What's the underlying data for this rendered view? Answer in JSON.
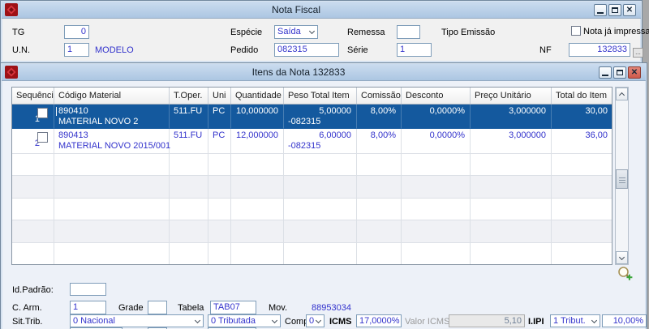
{
  "window1": {
    "title": "Nota Fiscal",
    "tg_label": "TG",
    "tg_value": "0",
    "un_label": "U.N.",
    "un_value": "1",
    "un_desc": "MODELO",
    "especie_label": "Espécie",
    "especie_value": "Saída",
    "pedido_label": "Pedido",
    "pedido_value": "082315",
    "remessa_label": "Remessa",
    "remessa_value": "",
    "serie_label": "Série",
    "serie_value": "1",
    "tipo_emissao_label": "Tipo Emissão",
    "nota_impressa_label": "Nota já impressa",
    "nf_label": "NF",
    "nf_value": "132833",
    "nf_browse_label": "..."
  },
  "window2": {
    "title": "Itens da Nota 132833",
    "table": {
      "headers": [
        "Sequência",
        "Código Material",
        "T.Oper.",
        "Uni",
        "Quantidade",
        "Peso Total Item",
        "Comissão",
        "Desconto",
        "Preço Unitário",
        "Total do Item"
      ],
      "rows": [
        {
          "seq": "1",
          "code": "890410",
          "desc": "MATERIAL NOVO 2",
          "toper": "511.FU",
          "uni": "PC",
          "qty": "10,000000",
          "ref": "-082315",
          "peso": "5,00000",
          "comissao": "8,00%",
          "desconto": "0,0000%",
          "preco": "3,000000",
          "total": "30,00",
          "selected": true
        },
        {
          "seq": "2",
          "code": "890413",
          "desc": "MATERIAL NOVO 2015/001",
          "toper": "511.FU",
          "uni": "PC",
          "qty": "12,000000",
          "ref": "-082315",
          "peso": "6,00000",
          "comissao": "8,00%",
          "desconto": "0,0000%",
          "preco": "3,000000",
          "total": "36,00",
          "selected": false
        }
      ]
    },
    "panel": {
      "id_padrao_label": "Id.Padrão:",
      "id_padrao_value": "",
      "c_arm_label": "C. Arm.",
      "c_arm_value": "1",
      "grade_label": "Grade",
      "grade_value": "",
      "tabela_label": "Tabela",
      "tabela_value": "TAB07",
      "mov_label": "Mov.",
      "mov_value": "88953034",
      "sit_trib_label": "Sit.Trib.",
      "sit_trib_value": "0 Nacional",
      "tributada_value": "0 Tributada",
      "compl_label": "Compl",
      "compl_value": "0",
      "icms_label": "ICMS",
      "icms_value": "17,0000%",
      "valor_icms_label": "Valor ICMS",
      "valor_icms_value": "5,10",
      "ipi_label": "I.IPI",
      "ipi_value": "1 Tribut.",
      "ipi_percent": "10,00%"
    }
  },
  "colors": {
    "selected_row": "#14599E",
    "value_text": "#3333CC",
    "titlebar": "#BCD2EA",
    "close_button_hot": "#D96A5D"
  }
}
